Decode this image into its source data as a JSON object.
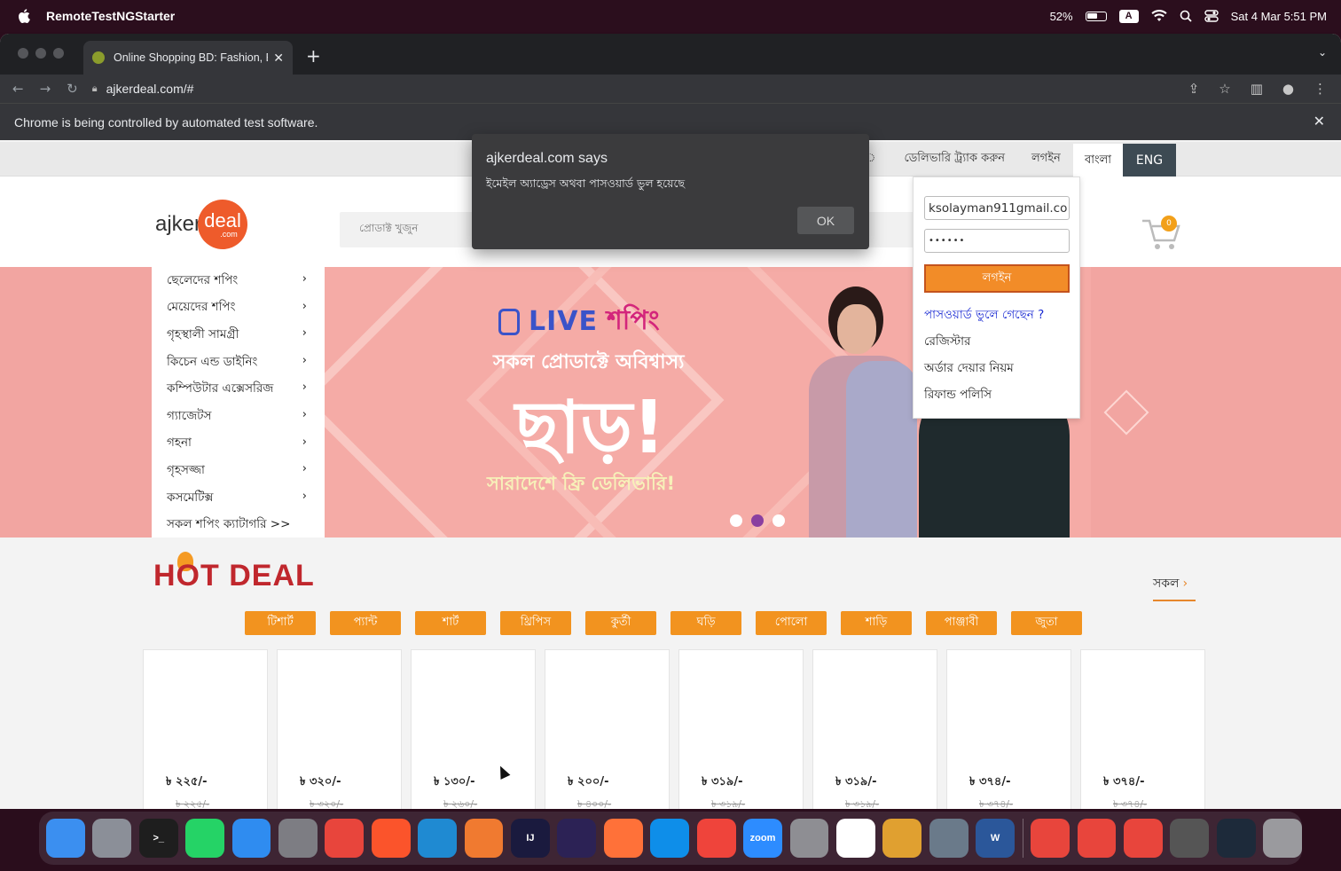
{
  "menubar": {
    "app_name": "RemoteTestNGStarter",
    "battery": "52%",
    "input_source": "A",
    "datetime": "Sat 4 Mar  5:51 PM"
  },
  "browser": {
    "tab_title": "Online Shopping BD: Fashion, E",
    "url": "ajkerdeal.com/#",
    "infobar_text": "Chrome is being controlled by automated test software."
  },
  "alert": {
    "title": "ajkerdeal.com says",
    "message": "ইমেইল অ্যাড্রেস অথবা পাসওয়ার্ড ভুল হয়েছে",
    "ok_label": "OK"
  },
  "topnav": {
    "partial_link": "ে",
    "track_delivery": "ডেলিভারি ট্র্যাক করুন",
    "login": "লগইন",
    "lang_bn": "বাংলা",
    "lang_en": "ENG"
  },
  "header": {
    "logo_text": "ajker",
    "logo_circle": "deal",
    "logo_small": ".com",
    "search_placeholder": "প্রোডাক্ট খুজুন",
    "cart_count": "0"
  },
  "login_form": {
    "email_value": "ksolayman911gmail.co",
    "password_value": "••••••",
    "login_button": "লগইন",
    "forgot_password": "পাসওয়ার্ড ভুলে গেছেন ?",
    "register": "রেজিস্টার",
    "order_rules": "অর্ডার দেয়ার নিয়ম",
    "refund_policy": "রিফান্ড পলিসি"
  },
  "categories": [
    "ছেলেদের শপিং",
    "মেয়েদের শপিং",
    "গৃহস্থালী সামগ্রী",
    "কিচেন এন্ড ডাইনিং",
    "কম্পিউটার এক্সেসরিজ",
    "গ্যাজেটস",
    "গহনা",
    "গৃহসজ্জা",
    "কসমেটিক্স",
    "সকল শপিং ক্যাটাগরি >>"
  ],
  "banner": {
    "live": "LIVE",
    "shopping": "শপিং",
    "subtitle": "সকল প্রোডাক্টে অবিশ্বাস্য",
    "big": "ছাড়!",
    "free_delivery": "সারাদেশে ফ্রি ডেলিভারি!",
    "active_slide": 2,
    "slide_count": 3
  },
  "hot_deal": {
    "title": "HOT DEAL",
    "all_link": "সকল",
    "tabs": [
      "টিশার্ট",
      "প্যান্ট",
      "শার্ট",
      "থ্রিপিস",
      "কুর্তী",
      "ঘড়ি",
      "পোলো",
      "শাড়ি",
      "পাঞ্জাবী",
      "জুতা"
    ],
    "products": [
      {
        "price": "৳ ২২৫/-",
        "old_price": "৳ ২২৫/-"
      },
      {
        "price": "৳ ৩২০/-",
        "old_price": "৳ ৩২০/-"
      },
      {
        "price": "৳ ১৩০/-",
        "old_price": "৳ ২৬০/-"
      },
      {
        "price": "৳ ২০০/-",
        "old_price": "৳ ৪০০/-"
      },
      {
        "price": "৳ ৩১৯/-",
        "old_price": "৳ ৩১৯/-"
      },
      {
        "price": "৳ ৩১৯/-",
        "old_price": "৳ ৩১৯/-"
      },
      {
        "price": "৳ ৩৭৪/-",
        "old_price": "৳ ৩৭৪/-"
      },
      {
        "price": "৳ ৩৭৪/-",
        "old_price": "৳ ৩৭৪/-"
      }
    ]
  },
  "dock": [
    {
      "name": "finder-icon",
      "color": "#3b8ff0",
      "label": ""
    },
    {
      "name": "launchpad-icon",
      "color": "#8b8f98",
      "label": ""
    },
    {
      "name": "terminal-icon",
      "color": "#1e1e1e",
      "label": ">_"
    },
    {
      "name": "whatsapp-icon",
      "color": "#25d366",
      "label": ""
    },
    {
      "name": "safari-icon",
      "color": "#2f8cf0",
      "label": ""
    },
    {
      "name": "system-preferences-icon",
      "color": "#7d7d83",
      "label": ""
    },
    {
      "name": "chrome-icon",
      "color": "#e8453c",
      "label": ""
    },
    {
      "name": "brave-icon",
      "color": "#fb542b",
      "label": ""
    },
    {
      "name": "vscode-icon",
      "color": "#1f8ad2",
      "label": ""
    },
    {
      "name": "pen-app-icon",
      "color": "#f07a30",
      "label": ""
    },
    {
      "name": "intellij-icon",
      "color": "#1a1a3e",
      "label": "IJ"
    },
    {
      "name": "eclipse-icon",
      "color": "#2c2255",
      "label": ""
    },
    {
      "name": "firefox-icon",
      "color": "#ff7139",
      "label": ""
    },
    {
      "name": "teamviewer-icon",
      "color": "#0e8ee9",
      "label": ""
    },
    {
      "name": "anydesk-icon",
      "color": "#ef443b",
      "label": ""
    },
    {
      "name": "zoom-icon",
      "color": "#2d8cff",
      "label": "zoom"
    },
    {
      "name": "settings-gear-icon",
      "color": "#8e8e93",
      "label": ""
    },
    {
      "name": "app-store-icon",
      "color": "#ffffff",
      "label": ""
    },
    {
      "name": "preview-icon",
      "color": "#e0a030",
      "label": ""
    },
    {
      "name": "proxyman-icon",
      "color": "#6a7a8a",
      "label": ""
    },
    {
      "name": "word-icon",
      "color": "#2b579a",
      "label": "W"
    },
    {
      "name": "chrome-icon-2",
      "color": "#e8453c",
      "label": ""
    },
    {
      "name": "chrome-icon-3",
      "color": "#e8453c",
      "label": ""
    },
    {
      "name": "chrome-icon-4",
      "color": "#e8453c",
      "label": ""
    },
    {
      "name": "app-window-icon",
      "color": "#555",
      "label": ""
    },
    {
      "name": "screen-thumbnail-icon",
      "color": "#1d2a3a",
      "label": ""
    },
    {
      "name": "trash-icon",
      "color": "#9a9a9e",
      "label": ""
    }
  ]
}
